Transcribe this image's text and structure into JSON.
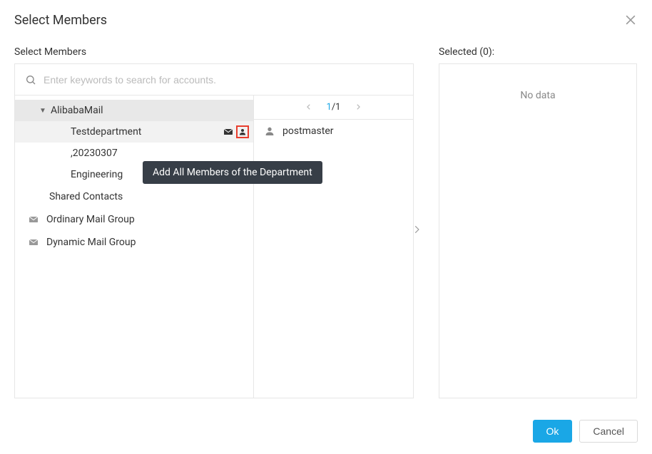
{
  "dialog": {
    "title": "Select Members",
    "leftLabel": "Select Members",
    "rightLabel": "Selected (0):"
  },
  "search": {
    "placeholder": "Enter keywords to search for accounts."
  },
  "tree": {
    "root": "AlibabaMail",
    "children": [
      "Testdepartment",
      ",20230307",
      "Engineering"
    ],
    "shared": "Shared Contacts",
    "groups": [
      "Ordinary Mail Group",
      "Dynamic Mail Group"
    ]
  },
  "pagination": {
    "current": "1",
    "total": "/1"
  },
  "members": [
    "postmaster"
  ],
  "tooltip": "Add All Members of the Department",
  "selected": {
    "empty": "No data"
  },
  "buttons": {
    "ok": "Ok",
    "cancel": "Cancel"
  }
}
